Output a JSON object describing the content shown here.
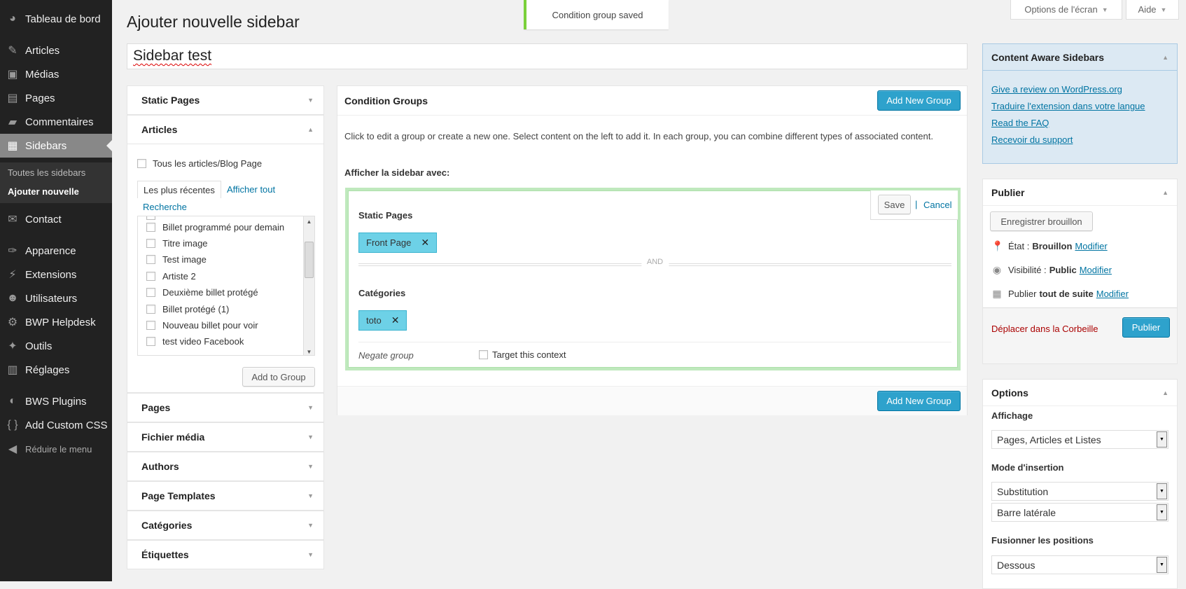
{
  "admin_menu": {
    "items": [
      {
        "label": "Tableau de bord",
        "icon": "dashboard-icon",
        "glyph": "◕"
      },
      {
        "label": "Articles",
        "icon": "pin-icon",
        "glyph": "✎"
      },
      {
        "label": "Médias",
        "icon": "media-icon",
        "glyph": "▣"
      },
      {
        "label": "Pages",
        "icon": "pages-icon",
        "glyph": "▤"
      },
      {
        "label": "Commentaires",
        "icon": "comments-icon",
        "glyph": "▰"
      },
      {
        "label": "Sidebars",
        "icon": "sidebars-icon",
        "glyph": "▦"
      },
      {
        "label": "Contact",
        "icon": "mail-icon",
        "glyph": "✉"
      },
      {
        "label": "Apparence",
        "icon": "appearance-icon",
        "glyph": "✑"
      },
      {
        "label": "Extensions",
        "icon": "plugins-icon",
        "glyph": "⚡"
      },
      {
        "label": "Utilisateurs",
        "icon": "users-icon",
        "glyph": "☻"
      },
      {
        "label": "BWP Helpdesk",
        "icon": "helpdesk-icon",
        "glyph": "⚙"
      },
      {
        "label": "Outils",
        "icon": "tools-icon",
        "glyph": "✦"
      },
      {
        "label": "Réglages",
        "icon": "settings-icon",
        "glyph": "▥"
      },
      {
        "label": "BWS Plugins",
        "icon": "bws-icon",
        "glyph": "◐"
      },
      {
        "label": "Add Custom CSS",
        "icon": "css-icon",
        "glyph": "{ }"
      },
      {
        "label": "Réduire le menu",
        "icon": "collapse-icon",
        "glyph": "◀"
      }
    ],
    "submenu": [
      "Toutes les sidebars",
      "Ajouter nouvelle"
    ]
  },
  "notice": "Condition group saved",
  "screen_options": "Options de l'écran",
  "help": "Aide",
  "page_title": "Ajouter nouvelle sidebar",
  "sidebar_title_value": "Sidebar test",
  "left_panel": {
    "sections_top": [
      "Static Pages",
      "Articles"
    ],
    "all_posts_label": "Tous les articles/Blog Page",
    "tabs": {
      "recent": "Les plus récentes",
      "all": "Afficher tout",
      "search": "Recherche"
    },
    "posts": [
      "Billet programmé pour demain",
      "Titre image",
      "Test image",
      "Artiste 2",
      "Deuxième billet protégé",
      "Billet protégé (1)",
      "Nouveau billet pour voir",
      "test video Facebook"
    ],
    "add_to_group": "Add to Group",
    "sections_bottom": [
      "Pages",
      "Fichier média",
      "Authors",
      "Page Templates",
      "Catégories",
      "Étiquettes"
    ]
  },
  "condition_groups": {
    "title": "Condition Groups",
    "add_new_group": "Add New Group",
    "description": "Click to edit a group or create a new one. Select content on the left to add it. In each group, you can combine different types of associated content.",
    "show_with_label": "Afficher la sidebar avec:",
    "group": {
      "save": "Save",
      "pipe": "|",
      "cancel": "Cancel",
      "static_pages_title": "Static Pages",
      "static_pages_tag": "Front Page",
      "and_label": "AND",
      "categories_title": "Catégories",
      "categories_tag": "toto",
      "remove_glyph": "✕",
      "negate": "Negate group",
      "target": "Target this context"
    }
  },
  "cas_box": {
    "title": "Content Aware Sidebars",
    "links": [
      "Give a review on WordPress.org",
      "Traduire l'extension dans votre langue",
      "Read the FAQ",
      "Recevoir du support"
    ]
  },
  "publish_box": {
    "title": "Publier",
    "save_draft": "Enregistrer brouillon",
    "status_label": "État :",
    "status_value": "Brouillon",
    "visibility_label": "Visibilité :",
    "visibility_value": "Public",
    "publish_label": "Publier",
    "publish_value": "tout de suite",
    "edit": "Modifier",
    "trash": "Déplacer dans la Corbeille",
    "publish_button": "Publier"
  },
  "options_box": {
    "title": "Options",
    "display_label": "Affichage",
    "display_value": "Pages, Articles et Listes",
    "insertion_label": "Mode d'insertion",
    "insertion_value": "Substitution",
    "sidebar_value": "Barre latérale",
    "merge_label": "Fusionner les positions",
    "merge_value": "Dessous"
  },
  "colors": {
    "admin_bg": "#222222",
    "accent_blue": "#2ea2cc",
    "tag_blue": "#6dd1e7",
    "group_border_green": "#bfe9bd",
    "notice_green": "#7ad03a"
  }
}
